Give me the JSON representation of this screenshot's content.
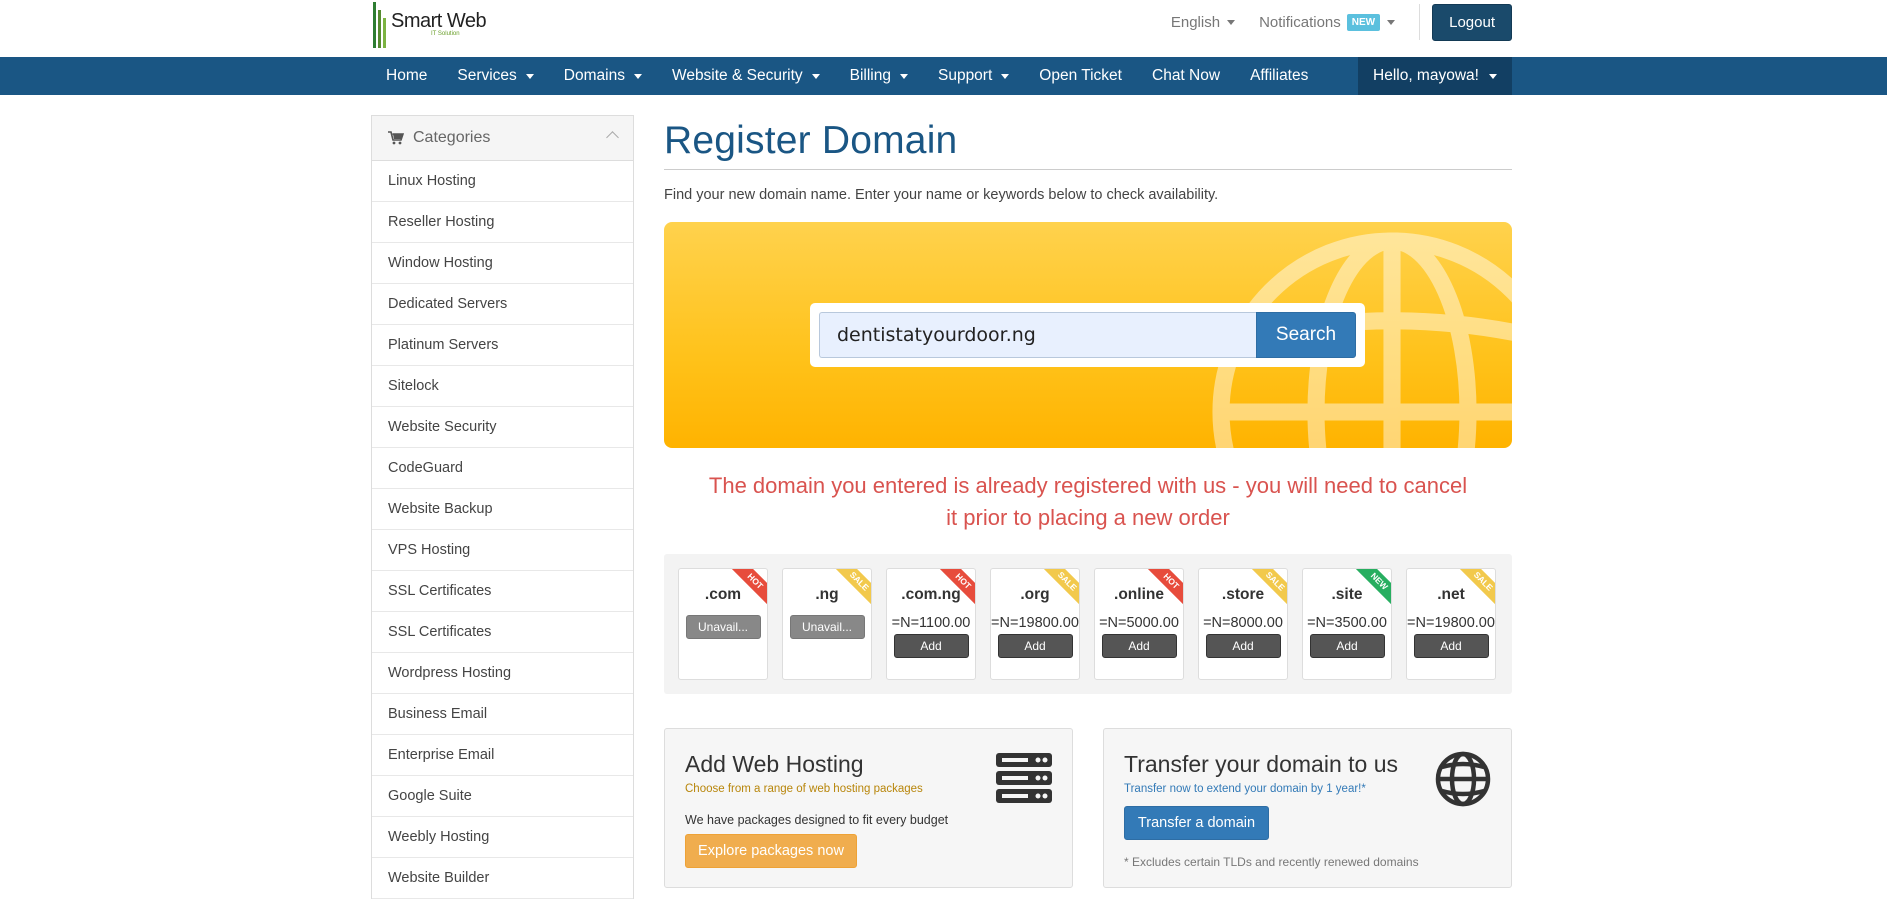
{
  "brand": {
    "name": "Smart Web",
    "tagline": "IT Solution"
  },
  "header": {
    "language": "English",
    "notifications": "Notifications",
    "notifications_badge": "NEW",
    "logout": "Logout"
  },
  "nav": {
    "items": [
      {
        "label": "Home",
        "dropdown": false
      },
      {
        "label": "Services",
        "dropdown": true
      },
      {
        "label": "Domains",
        "dropdown": true
      },
      {
        "label": "Website & Security",
        "dropdown": true
      },
      {
        "label": "Billing",
        "dropdown": true
      },
      {
        "label": "Support",
        "dropdown": true
      },
      {
        "label": "Open Ticket",
        "dropdown": false
      },
      {
        "label": "Chat Now",
        "dropdown": false
      },
      {
        "label": "Affiliates",
        "dropdown": false
      }
    ],
    "user": "Hello, mayowa!"
  },
  "sidebar": {
    "title": "Categories",
    "items": [
      "Linux Hosting",
      "Reseller Hosting",
      "Window Hosting",
      "Dedicated Servers",
      "Platinum Servers",
      "Sitelock",
      "Website Security",
      "CodeGuard",
      "Website Backup",
      "VPS Hosting",
      "SSL Certificates",
      "SSL Certificates",
      "Wordpress Hosting",
      "Business Email",
      "Enterprise Email",
      "Google Suite",
      "Weebly Hosting",
      "Website Builder"
    ]
  },
  "main": {
    "title": "Register Domain",
    "lead": "Find your new domain name. Enter your name or keywords below to check availability.",
    "search_value": "dentistatyourdoor.ng",
    "search_button": "Search",
    "alert": "The domain you entered is already registered with us - you will need to cancel it prior to placing a new order"
  },
  "tlds": [
    {
      "name": ".com",
      "price": "",
      "button": "Unavail...",
      "available": false,
      "ribbon": "HOT"
    },
    {
      "name": ".ng",
      "price": "",
      "button": "Unavail...",
      "available": false,
      "ribbon": "SALE"
    },
    {
      "name": ".com.ng",
      "price": "=N=1100.00",
      "button": "Add",
      "available": true,
      "ribbon": "HOT"
    },
    {
      "name": ".org",
      "price": "=N=19800.00",
      "button": "Add",
      "available": true,
      "ribbon": "SALE"
    },
    {
      "name": ".online",
      "price": "=N=5000.00",
      "button": "Add",
      "available": true,
      "ribbon": "HOT"
    },
    {
      "name": ".store",
      "price": "=N=8000.00",
      "button": "Add",
      "available": true,
      "ribbon": "SALE"
    },
    {
      "name": ".site",
      "price": "=N=3500.00",
      "button": "Add",
      "available": true,
      "ribbon": "NEW"
    },
    {
      "name": ".net",
      "price": "=N=19800.00",
      "button": "Add",
      "available": true,
      "ribbon": "SALE"
    }
  ],
  "hosting_panel": {
    "title": "Add Web Hosting",
    "subtitle": "Choose from a range of web hosting packages",
    "text": "We have packages designed to fit every budget",
    "button": "Explore packages now",
    "icon": "server-icon"
  },
  "transfer_panel": {
    "title": "Transfer your domain to us",
    "subtitle": "Transfer now to extend your domain by 1 year!*",
    "button": "Transfer a domain",
    "note": "* Excludes certain TLDs and recently renewed domains",
    "icon": "globe-icon"
  },
  "colors": {
    "primary": "#1a5684",
    "nav_bg": "#1a5684",
    "hero_yellow": "#ffc21a",
    "alert_red": "#d9534f",
    "hot": "#e74c3c",
    "sale": "#f2c94c",
    "new": "#27ae60",
    "orange_btn": "#f0ad4e",
    "blue_btn": "#337ab7"
  }
}
